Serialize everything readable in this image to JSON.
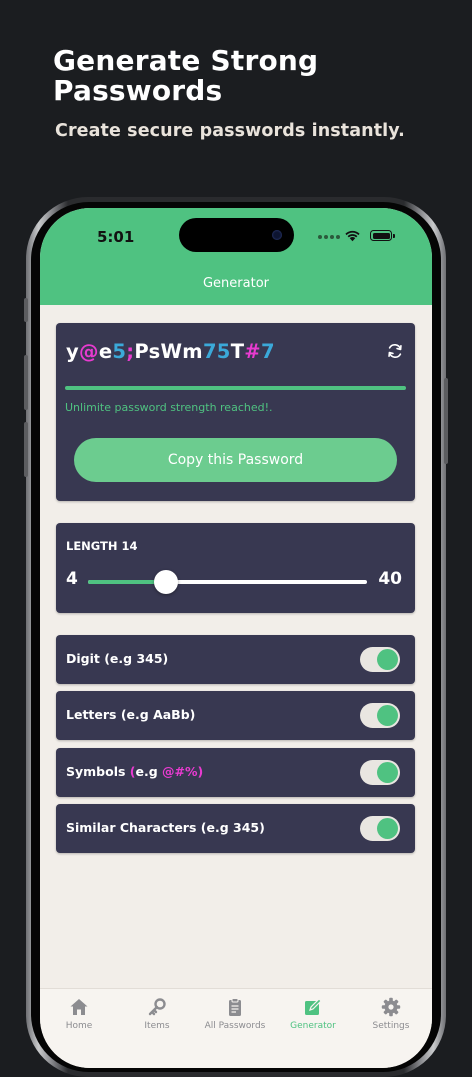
{
  "promo": {
    "title": "Generate Strong Passwords",
    "subtitle": "Create secure passwords instantly."
  },
  "status_bar": {
    "time": "5:01"
  },
  "nav": {
    "title": "Generator"
  },
  "password": {
    "segments": [
      {
        "text": "y",
        "color": "#ffffff"
      },
      {
        "text": "@",
        "color": "#e83bd0"
      },
      {
        "text": "e",
        "color": "#ffffff"
      },
      {
        "text": "5",
        "color": "#3ba9d9"
      },
      {
        "text": ";",
        "color": "#e83bd0"
      },
      {
        "text": "PsWm",
        "color": "#ffffff"
      },
      {
        "text": "75",
        "color": "#3ba9d9"
      },
      {
        "text": "T",
        "color": "#ffffff"
      },
      {
        "text": "#",
        "color": "#e83bd0"
      },
      {
        "text": "7",
        "color": "#3ba9d9"
      }
    ],
    "strength_message": "Unlimite password strength reached!.",
    "strength_level": 1.0,
    "copy_button_label": "Copy this Password",
    "refresh_icon": "refresh-icon"
  },
  "length": {
    "label": "LENGTH 14",
    "min": "4",
    "max": "40",
    "value": 14,
    "range": [
      4,
      40
    ]
  },
  "options": [
    {
      "label": "Digit (e.g 345)",
      "enabled": true
    },
    {
      "label": "Letters (e.g AaBb)",
      "enabled": true
    },
    {
      "label": "Symbols (e.g @#%)",
      "enabled": true
    },
    {
      "label": "Similar Characters (e.g 345)",
      "enabled": true
    }
  ],
  "tabbar": {
    "tabs": [
      {
        "icon": "home-icon",
        "label": "Home",
        "active": false
      },
      {
        "icon": "key-icon",
        "label": "Items",
        "active": false
      },
      {
        "icon": "clipboard-icon",
        "label": "All Passwords",
        "active": false
      },
      {
        "icon": "edit-icon",
        "label": "Generator",
        "active": true
      },
      {
        "icon": "gear-icon",
        "label": "Settings",
        "active": false
      }
    ]
  },
  "colors": {
    "accent": "#4fc281",
    "card": "#383851",
    "background": "#f2eee9",
    "symbol": "#e83bd0",
    "digit": "#3ba9d9",
    "copy_button": "#6ccc8f",
    "strength_text": "#4fc281",
    "tab_inactive": "#8c8c90",
    "tab_active": "#4fc281"
  }
}
